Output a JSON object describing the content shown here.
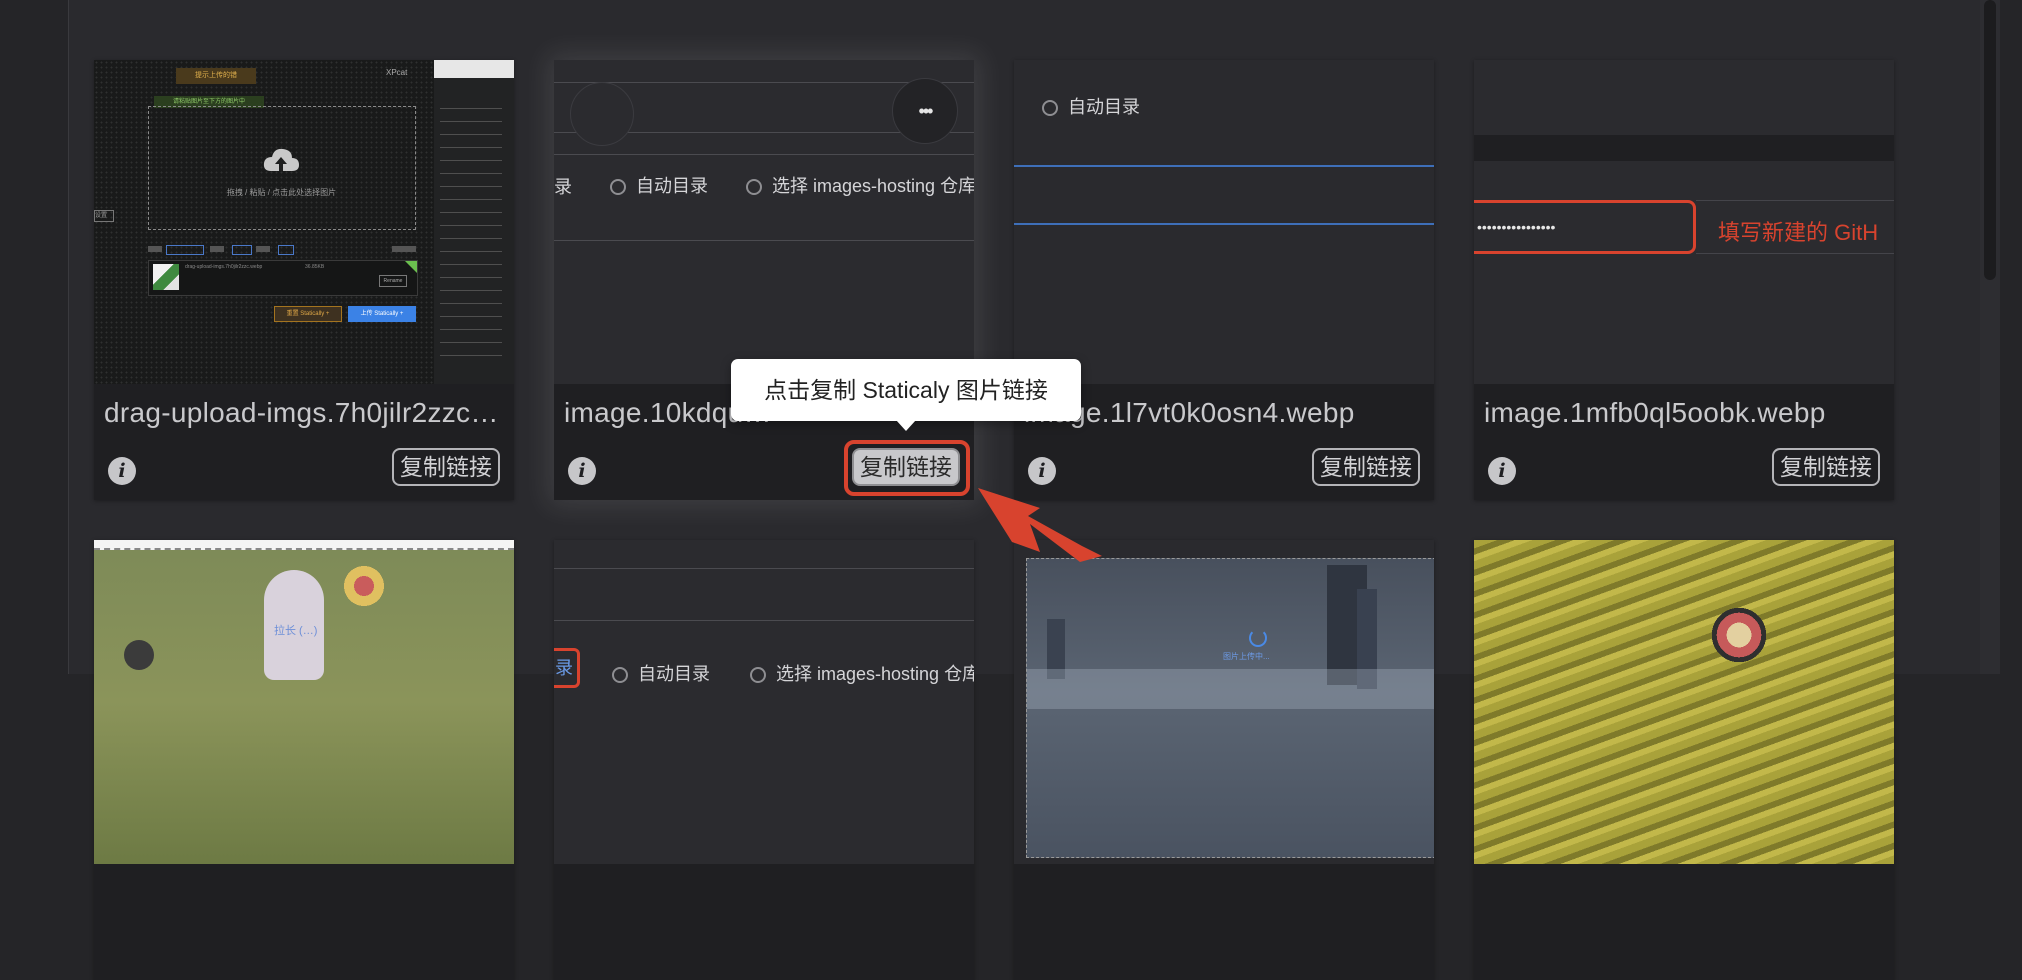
{
  "tooltip": {
    "text": "点击复制 Staticaly 图片链接"
  },
  "common": {
    "copy_label": "复制链接",
    "info_glyph": "i"
  },
  "cards": [
    {
      "filename": "drag-upload-imgs.7h0jilr2zzc…",
      "thumb": {
        "top_button": "提示上传的错",
        "nickname": "XPcat",
        "green_tip": "请粘贴图片至下方的图片中",
        "drop_text": "拖拽 / 粘贴 / 点击此处选择图片",
        "left_edge": "设置",
        "file_name": "drag-upload-imgs.7h0jilr2zzc.webp",
        "file_info": "36.85KB",
        "upload_button": "上传 Statically +",
        "cancel_button": "重置 Statically +",
        "rename_button": "Rename"
      }
    },
    {
      "filename": "image.10kdqu…",
      "thumb": {
        "dir_tail": "录",
        "auto_dir": "自动目录",
        "select_repo": "选择 images-hosting 仓库",
        "more_glyph": "•••"
      }
    },
    {
      "filename": "image.1l7vt0k0osn4.webp",
      "thumb": {
        "auto_dir": "自动目录"
      }
    },
    {
      "filename": "image.1mfb0ql5oobk.webp",
      "thumb": {
        "masked_token": "••••••••••••••••",
        "hint": "填写新建的 GitH"
      }
    },
    {
      "thumb": {
        "sub_text": "拉长  (…)"
      }
    },
    {
      "thumb": {
        "dir_tail": "录",
        "auto_dir": "自动目录",
        "select_repo": "选择 images-hosting 仓库"
      }
    },
    {
      "thumb": {
        "uploading_text": "图片上传中..."
      }
    },
    {
      "thumb": {}
    }
  ],
  "colors": {
    "highlight_red": "#d8432e",
    "accent_blue": "#3e6fb9",
    "tooltip_bg": "#ffffff"
  }
}
